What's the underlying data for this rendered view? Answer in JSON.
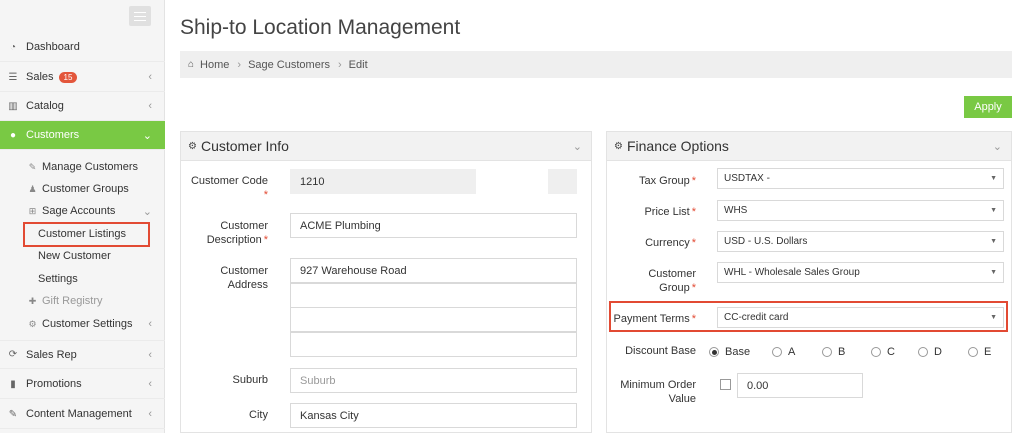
{
  "page_title": "Ship-to Location Management",
  "breadcrumb": {
    "home": "Home",
    "items": [
      "Sage Customers",
      "Edit"
    ]
  },
  "apply_label": "Apply",
  "sidebar": {
    "items": [
      {
        "label": "Dashboard",
        "icon": "dashboard-icon"
      },
      {
        "label": "Sales",
        "badge": "15",
        "icon": "sales-icon"
      },
      {
        "label": "Catalog",
        "icon": "catalog-icon"
      },
      {
        "label": "Customers",
        "icon": "user-icon"
      },
      {
        "label": "Sales Rep",
        "icon": "refresh-icon"
      },
      {
        "label": "Promotions",
        "icon": "bar-chart-icon"
      },
      {
        "label": "Content Management",
        "icon": "edit-icon"
      }
    ],
    "customers_sub": [
      {
        "label": "Manage Customers",
        "icon": "edit-icon"
      },
      {
        "label": "Customer Groups",
        "icon": "users-icon"
      },
      {
        "label": "Sage Accounts",
        "icon": "sitemap-icon"
      },
      {
        "label": "Customer Listings"
      },
      {
        "label": "New Customer"
      },
      {
        "label": "Settings"
      },
      {
        "label": "Gift Registry",
        "icon": "gift-icon"
      },
      {
        "label": "Customer Settings",
        "icon": "gear-icon"
      }
    ]
  },
  "customer_info": {
    "title": "Customer Info",
    "fields": {
      "code_label": "Customer Code",
      "code_value": "1210",
      "desc_label_1": "Customer",
      "desc_label_2": "Description",
      "desc_value": "ACME Plumbing",
      "addr_label_1": "Customer",
      "addr_label_2": "Address",
      "addr_value": "927 Warehouse Road",
      "suburb_label": "Suburb",
      "suburb_placeholder": "Suburb",
      "city_label": "City",
      "city_value": "Kansas City"
    }
  },
  "finance": {
    "title": "Finance Options",
    "tax_label": "Tax Group",
    "tax_value": "USDTAX -",
    "price_label": "Price List",
    "price_value": "WHS",
    "currency_label": "Currency",
    "currency_value": "USD - U.S. Dollars",
    "group_label_1": "Customer",
    "group_label_2": "Group",
    "group_value": "WHL - Wholesale Sales Group",
    "terms_label": "Payment Terms",
    "terms_value": "CC-credit card",
    "discount_label": "Discount Base",
    "discount_options": [
      "Base",
      "A",
      "B",
      "C",
      "D",
      "E"
    ],
    "discount_selected": "Base",
    "min_label_1": "Minimum Order",
    "min_label_2": "Value",
    "min_value": "0.00"
  },
  "colors": {
    "accent_green": "#79c944",
    "highlight_red": "#e24a33",
    "badge_red": "#e3563b"
  }
}
